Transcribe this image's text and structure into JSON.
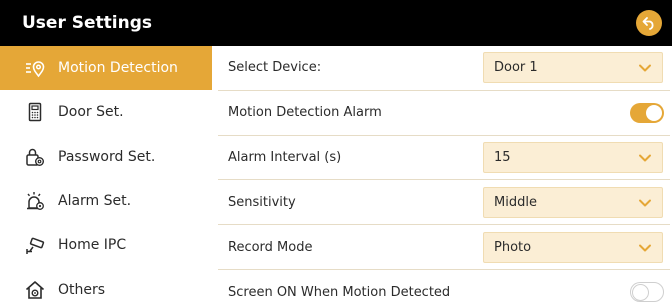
{
  "header": {
    "title": "User Settings",
    "back_icon": "back-arrow-icon"
  },
  "colors": {
    "accent": "#e5a737",
    "select_bg": "#fbeed5",
    "titlebar_bg": "#000000"
  },
  "sidebar": {
    "items": [
      {
        "label": "Motion Detection",
        "icon": "motion-detection-icon",
        "active": true
      },
      {
        "label": "Door Set.",
        "icon": "door-panel-icon",
        "active": false
      },
      {
        "label": "Password Set.",
        "icon": "lock-icon",
        "active": false
      },
      {
        "label": "Alarm Set.",
        "icon": "alarm-icon",
        "active": false
      },
      {
        "label": "Home IPC",
        "icon": "camera-icon",
        "active": false
      },
      {
        "label": "Others",
        "icon": "home-gear-icon",
        "active": false
      }
    ]
  },
  "settings": {
    "select_device": {
      "label": "Select Device:",
      "value": "Door 1"
    },
    "motion_alarm": {
      "label": "Motion Detection Alarm",
      "enabled": true
    },
    "alarm_interval": {
      "label": "Alarm Interval (s)",
      "value": "15"
    },
    "sensitivity": {
      "label": "Sensitivity",
      "value": "Middle"
    },
    "record_mode": {
      "label": "Record Mode",
      "value": "Photo"
    },
    "screen_on": {
      "label": "Screen ON When Motion Detected",
      "enabled": false
    }
  }
}
